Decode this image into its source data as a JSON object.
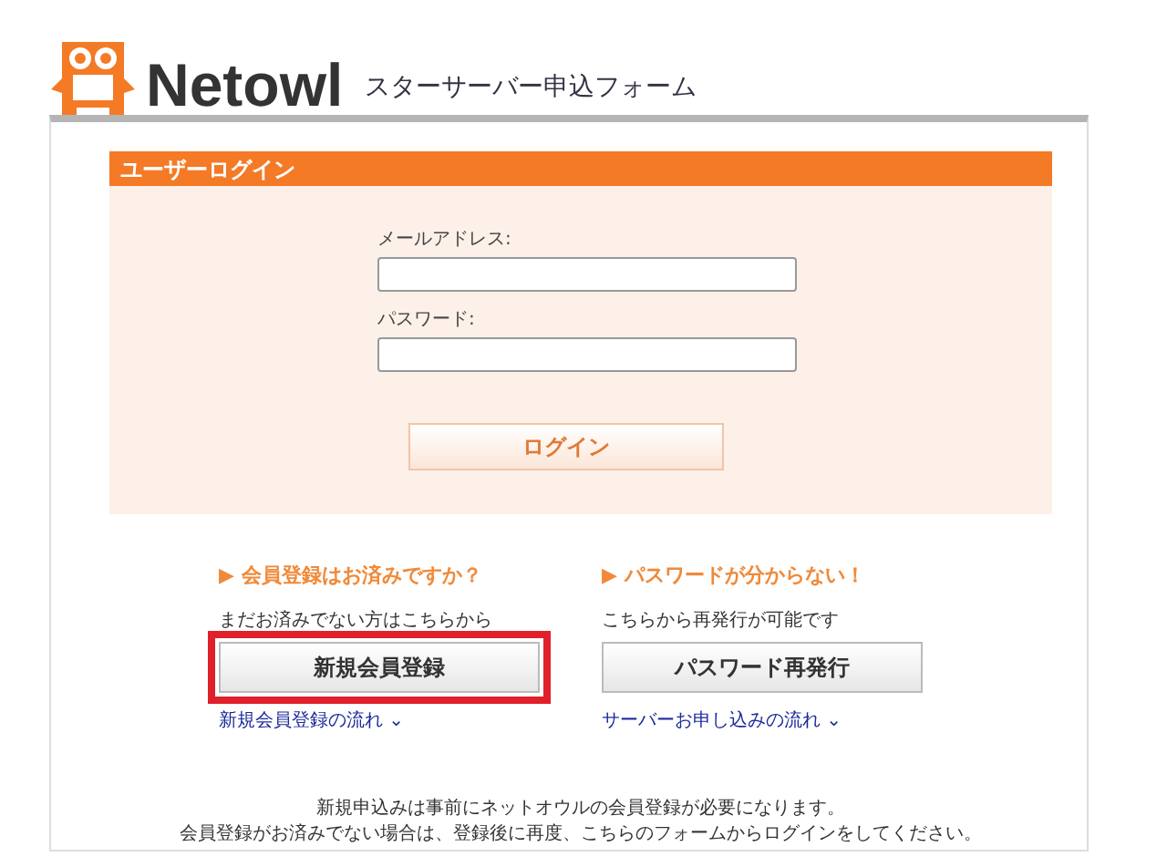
{
  "header": {
    "brand": "Netowl",
    "subtitle": "スターサーバー申込フォーム"
  },
  "login": {
    "title": "ユーザーログイン",
    "fields": [
      {
        "label": "メールアドレス:"
      },
      {
        "label": "パスワード:"
      }
    ],
    "button": "ログイン"
  },
  "sections": [
    {
      "heading": "▶ 会員登録はお済みですか？",
      "text": "まだお済みでない方はこちらから",
      "button": "新規会員登録",
      "highlighted": true,
      "link": "新規会員登録の流れ ⌄"
    },
    {
      "heading": "▶ パスワードが分からない！",
      "text": "こちらから再発行が可能です",
      "button": "パスワード再発行",
      "highlighted": false,
      "link": "サーバーお申し込みの流れ ⌄"
    }
  ],
  "notes": [
    "新規申込みは事前にネットオウルの会員登録が必要になります。",
    "会員登録がお済みでない場合は、登録後に再度、こちらのフォームからログインをしてください。"
  ]
}
